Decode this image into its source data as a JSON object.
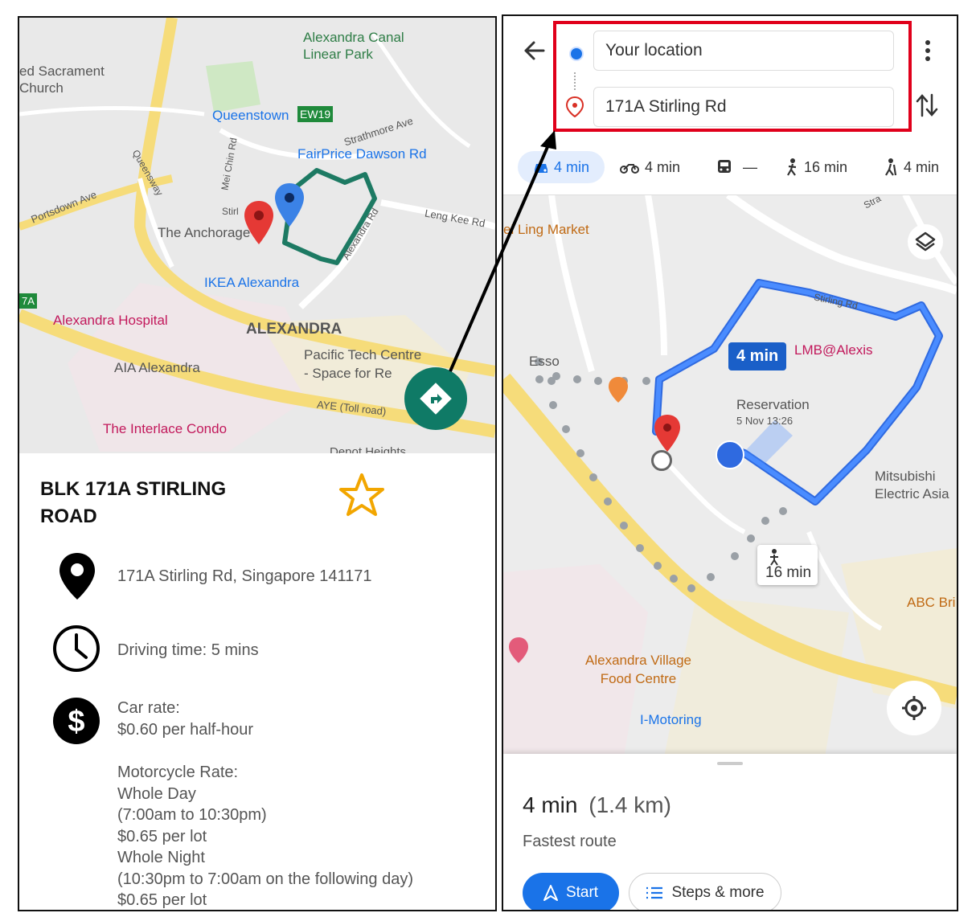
{
  "left_panel": {
    "map": {
      "labels": {
        "park": "Alexandra Canal\nLinear Park",
        "church": "ed Sacrament\nChurch",
        "mrt": "Queenstown",
        "mrt_code": "EW19",
        "strathmore": "Strathmore Ave",
        "fairprice": "FairPrice Dawson Rd",
        "mei_chin": "Mei Chin Rd",
        "queensway": "Queensway",
        "portsdown": "Portsdown Ave",
        "stirling": "Stirl",
        "anchorage": "The Anchorage",
        "alexandra_rd": "Alexandra Rd",
        "leng_kee": "Leng Kee Rd",
        "ikea": "IKEA Alexandra",
        "hospital": "Alexandra Hospital",
        "district": "ALEXANDRA",
        "pacific": "Pacific Tech Centre\n- Space for Re",
        "aia": "AIA Alexandra",
        "aye": "AYE (Toll road)",
        "interlace": "The Interlace Condo",
        "depot": "Depot Heights",
        "seven_a": "7A"
      }
    },
    "place": {
      "title": "BLK 171A STIRLING\nROAD",
      "address": "171A Stirling Rd, Singapore 141171",
      "driving_time": "Driving time: 5 mins",
      "car_rate": "Car rate:\n$0.60 per half-hour",
      "moto_rate": "Motorcycle Rate:\nWhole Day\n(7:00am to 10:30pm)\n$0.65 per lot\nWhole Night\n(10:30pm to 7:00am on the following day)\n$0.65 per lot"
    },
    "icons": [
      "location-pin-icon",
      "clock-icon",
      "dollar-icon",
      "star-icon",
      "directions-icon"
    ]
  },
  "right_panel": {
    "origin": "Your location",
    "destination": "171A Stirling Rd",
    "modes": [
      {
        "icon": "car-icon",
        "label": "4 min"
      },
      {
        "icon": "motorcycle-icon",
        "label": "4 min"
      },
      {
        "icon": "transit-icon",
        "label": "—"
      },
      {
        "icon": "walk-icon",
        "label": "16 min"
      },
      {
        "icon": "hiking-icon",
        "label": "4 min"
      }
    ],
    "map": {
      "labels": {
        "mei_ling": "ei Ling Market",
        "stirling_rd": "Stirling Rd",
        "stra": "Stra",
        "esso": "Esso",
        "lmb": "LMB@Alexis",
        "reservation": "Reservation",
        "reservation_time": "5 Nov 13:26",
        "mitsubishi": "Mitsubishi\nElectric Asia",
        "abc": "ABC Bri",
        "village": "Alexandra Village\nFood Centre",
        "imotoring": "I-Motoring"
      },
      "drive_bubble": "4 min",
      "walk_bubble": "16 min"
    },
    "sheet": {
      "duration": "4 min",
      "distance": "(1.4 km)",
      "route_desc": "Fastest route",
      "start_label": "Start",
      "steps_label": "Steps & more"
    },
    "colors": {
      "route": "#4285f4",
      "highlight": "#e0001b",
      "accent": "#1a73e8"
    }
  }
}
